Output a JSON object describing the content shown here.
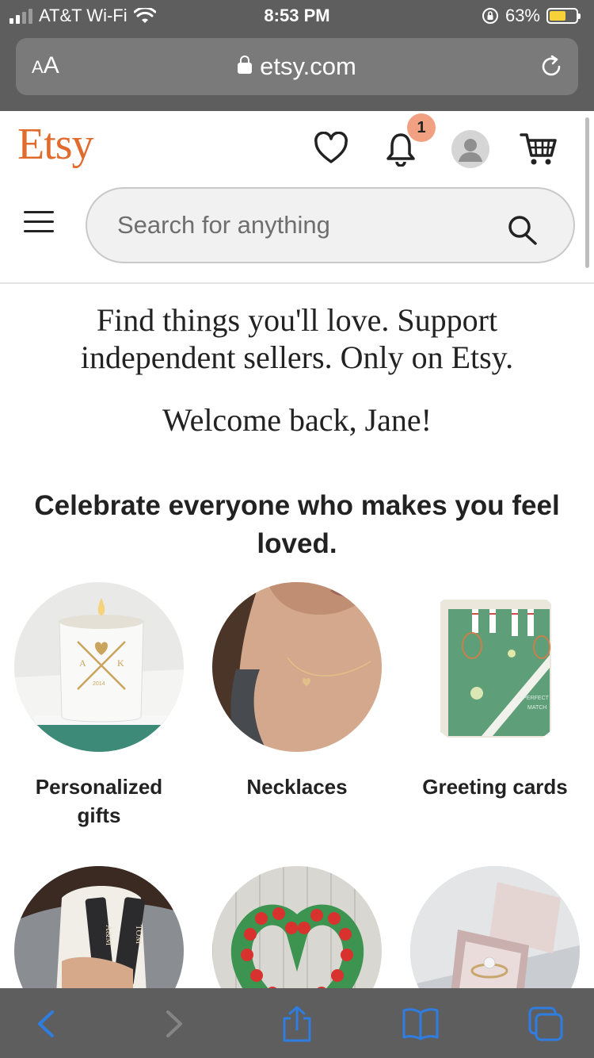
{
  "status_bar": {
    "carrier": "AT&T Wi-Fi",
    "time": "8:53 PM",
    "battery_percent": "63%",
    "battery_level": 0.63
  },
  "browser": {
    "text_size_label": "AA",
    "url": "etsy.com"
  },
  "header": {
    "logo": "Etsy",
    "notification_count": "1",
    "brand_color": "#e16a2d"
  },
  "search": {
    "placeholder": "Search for anything"
  },
  "hero": {
    "tagline": "Find things you'll love. Support independent sellers. Only on Etsy.",
    "welcome": "Welcome back, Jane!"
  },
  "section": {
    "title": "Celebrate everyone who makes you feel loved."
  },
  "categories": [
    {
      "label": "Personalized gifts",
      "image": "candle-photo"
    },
    {
      "label": "Necklaces",
      "image": "necklace-photo"
    },
    {
      "label": "Greeting cards",
      "image": "greeting-card-photo"
    },
    {
      "label": "",
      "image": "keychain-photo"
    },
    {
      "label": "",
      "image": "tulip-wreath-photo"
    },
    {
      "label": "",
      "image": "ring-box-photo"
    }
  ],
  "toolbar": {
    "icons": [
      "back-icon",
      "forward-icon",
      "share-icon",
      "bookmarks-icon",
      "tabs-icon"
    ],
    "accent": "#2f7de1"
  }
}
